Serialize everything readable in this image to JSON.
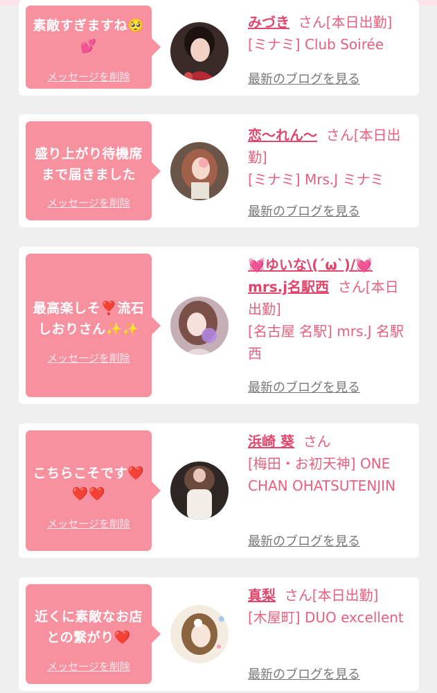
{
  "delete_label": "メッセージを削除",
  "blog_label": "最新のブログを見る",
  "honorific": "さん",
  "cards": [
    {
      "message_line1": "素敵すぎますね🥺",
      "message_line2": "💕",
      "name": "みづき",
      "status": "[本日出勤]",
      "shop": "[ミナミ] Club Soirée"
    },
    {
      "message_line1": "盛り上がり待機席",
      "message_line2": "まで届きました",
      "name": "恋〜れん〜",
      "status": "[本日出勤]",
      "shop": "[ミナミ] Mrs.J ミナミ"
    },
    {
      "message_line1": "最高楽しそ❣️流石",
      "message_line2": "しおりさん✨✨",
      "name": "💓ゆいな\\(´ω`)/💓mrs.j名駅西",
      "status": "[本日出勤]",
      "shop": "[名古屋 名駅] mrs.J 名駅西"
    },
    {
      "message_line1": "こちらこそです❤️",
      "message_line2": "❤️❤️",
      "name": "浜崎 葵",
      "status": "",
      "shop": "[梅田・お初天神] ONE CHAN OHATSUTENJIN"
    },
    {
      "message_line1": "近くに素敵なお店",
      "message_line2": "との繋がり❤️",
      "name": "真梨",
      "status": "[本日出勤]",
      "shop": "[木屋町] DUO excellent"
    }
  ]
}
